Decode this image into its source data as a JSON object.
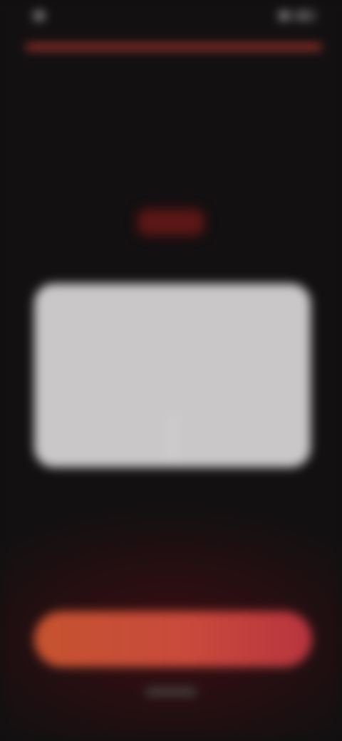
{
  "status_bar": {
    "time": "",
    "icons": [
      "signal-icon",
      "wifi-icon",
      "battery-icon"
    ]
  },
  "progress": {
    "value": 1.0,
    "color": "#b5372e"
  },
  "header": {
    "title": ""
  },
  "app_icon": {
    "name": "app-logo-icon",
    "color": "#5a1716"
  },
  "permission_dialog": {
    "title": "",
    "body": "",
    "deny_label": "",
    "allow_label": ""
  },
  "helper_text": "",
  "cta": {
    "label": "",
    "accent": "#c5532f"
  },
  "colors": {
    "background": "#121011",
    "dialog": "#c9c7c7"
  }
}
